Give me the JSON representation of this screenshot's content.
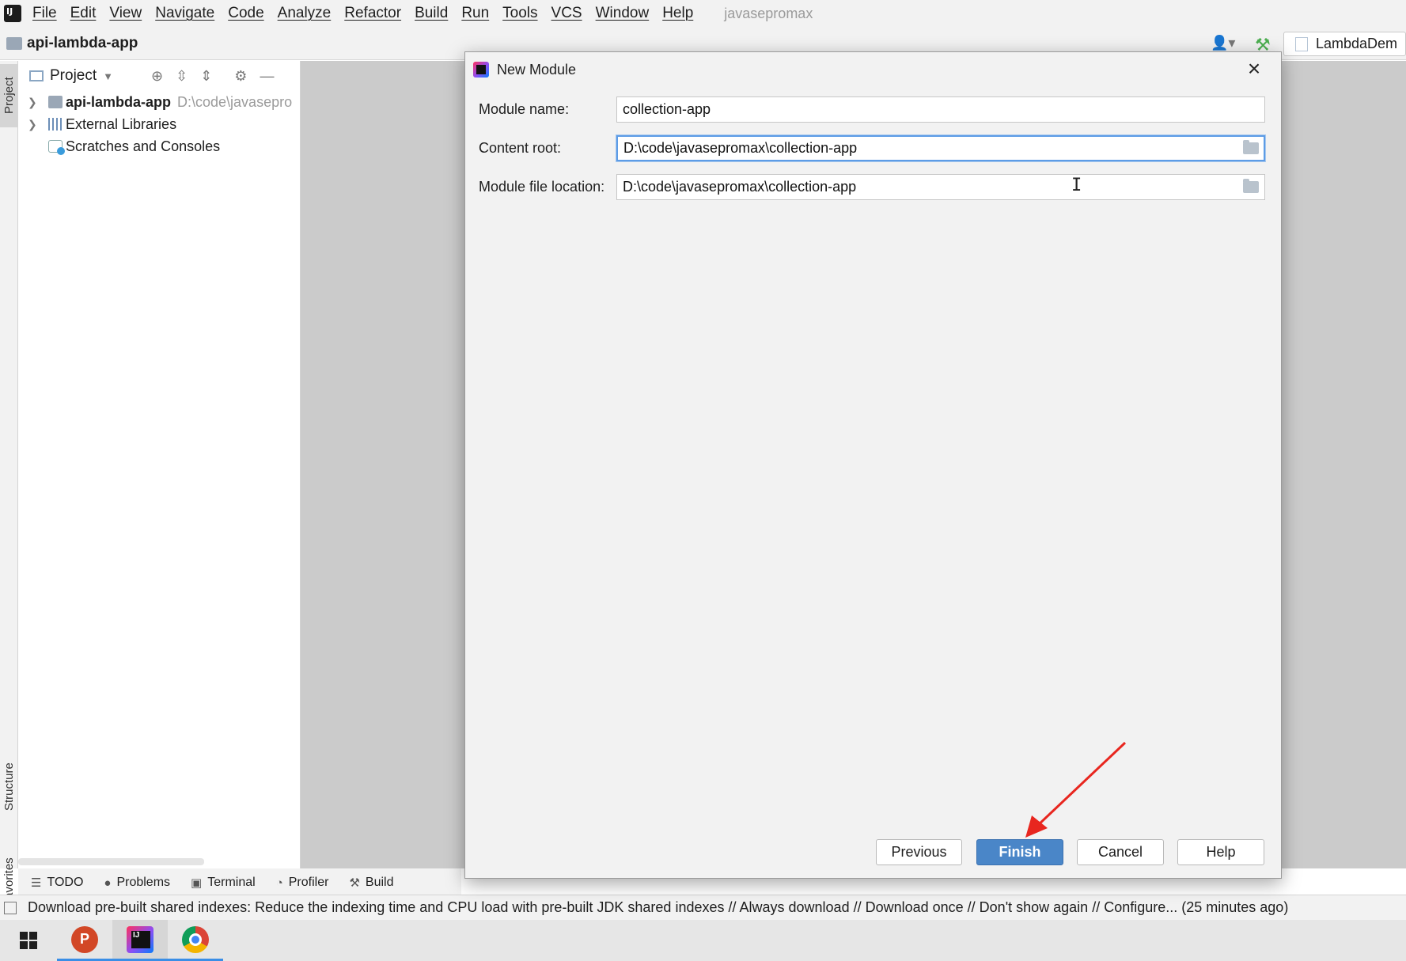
{
  "menubar": {
    "items": [
      "File",
      "Edit",
      "View",
      "Navigate",
      "Code",
      "Analyze",
      "Refactor",
      "Build",
      "Run",
      "Tools",
      "VCS",
      "Window",
      "Help"
    ],
    "project_name": "javasepromax"
  },
  "navbar": {
    "title": "api-lambda-app",
    "run_config": "LambdaDem"
  },
  "left_stripe": {
    "project": "Project",
    "structure": "Structure",
    "favorites": "Favorites"
  },
  "project_panel": {
    "title": "Project",
    "tree": [
      {
        "label": "api-lambda-app",
        "path": "D:\\code\\javasepro"
      },
      {
        "label": "External Libraries"
      },
      {
        "label": "Scratches and Consoles"
      }
    ]
  },
  "dialog": {
    "title": "New Module",
    "fields": {
      "module_name": {
        "label": "Module name:",
        "value": "collection-app"
      },
      "content_root": {
        "label": "Content root:",
        "value": "D:\\code\\javasepromax\\collection-app"
      },
      "module_file_location": {
        "label": "Module file location:",
        "value": "D:\\code\\javasepromax\\collection-app"
      }
    },
    "buttons": {
      "previous": "Previous",
      "finish": "Finish",
      "cancel": "Cancel",
      "help": "Help"
    }
  },
  "bottom_tabs": [
    "TODO",
    "Problems",
    "Terminal",
    "Profiler",
    "Build"
  ],
  "status_bar": {
    "text": "Download pre-built shared indexes: Reduce the indexing time and CPU load with pre-built JDK shared indexes // Always download // Download once // Don't show again // Configure... (25 minutes ago)"
  },
  "icons": {
    "annotation_arrow_color": "#e8261f",
    "finish_button_color": "#4a86c8",
    "focus_color": "#5d9ce6"
  }
}
